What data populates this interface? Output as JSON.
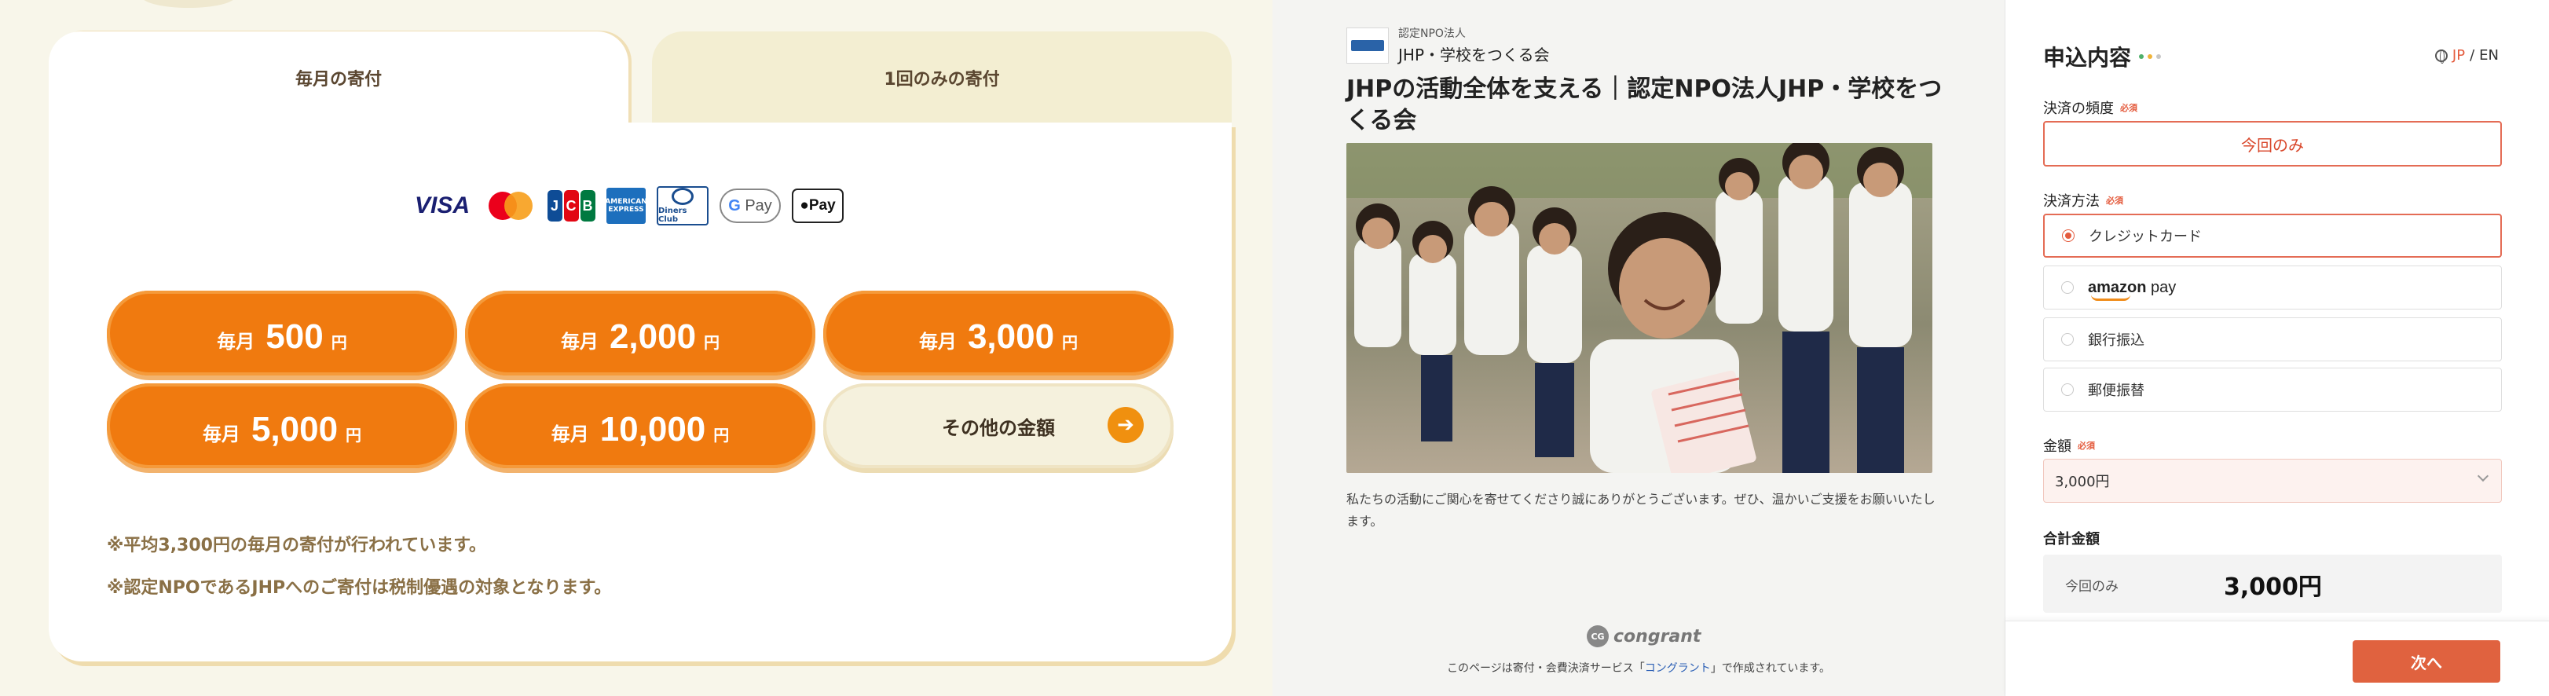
{
  "tabs": {
    "monthly": "毎月の寄付",
    "once": "1回のみの寄付"
  },
  "payment_logos": [
    "visa-icon",
    "mastercard-icon",
    "jcb-icon",
    "amex-icon",
    "diners-icon",
    "google-pay-icon",
    "apple-pay-icon"
  ],
  "logo_text": {
    "visa": "VISA",
    "gpay": "Pay",
    "apay": "Pay",
    "amex": "AMERICAN EXPRESS",
    "diners": "Diners Club"
  },
  "amounts": [
    {
      "prefix": "毎月",
      "value": "500",
      "suffix": "円"
    },
    {
      "prefix": "毎月",
      "value": "2,000",
      "suffix": "円"
    },
    {
      "prefix": "毎月",
      "value": "3,000",
      "suffix": "円"
    },
    {
      "prefix": "毎月",
      "value": "5,000",
      "suffix": "円"
    },
    {
      "prefix": "毎月",
      "value": "10,000",
      "suffix": "円"
    }
  ],
  "other_amount": "その他の金額",
  "notes": [
    "※平均3,300円の毎月の寄付が行われています。",
    "※認定NPOであるJHPへのご寄付は税制優遇の対象となります。"
  ],
  "org": {
    "tag": "認定NPO法人",
    "name": "JHP・学校をつくる会"
  },
  "campaign": {
    "title": "JHPの活動全体を支える｜認定NPO法人JHP・学校をつくる会",
    "description": "私たちの活動にご関心を寄せてくださり誠にありがとうございます。ぜひ、温かいご支援をお願いいたします。"
  },
  "brand": {
    "congrant": "congrant"
  },
  "footer": {
    "pre": "このページは寄付・会費決済サービス「",
    "link": "コングラント",
    "post": "」で作成されています。"
  },
  "form": {
    "title": "申込内容",
    "lang": {
      "jp": "JP",
      "sep": "/",
      "en": "EN"
    },
    "required": "必須",
    "frequency_label": "決済の頻度",
    "frequency_value": "今回のみ",
    "method_label": "決済方法",
    "methods": {
      "credit": "クレジットカード",
      "amazon_word": "amazon",
      "amazon_pay": "pay",
      "bank": "銀行振込",
      "postal": "郵便振替"
    },
    "amount_label": "金額",
    "amount_value": "3,000円",
    "total_label": "合計金額",
    "total_period": "今回のみ",
    "total_value": "3,000円",
    "next": "次へ"
  },
  "colors": {
    "orange": "#f07a0f",
    "accent_red": "#e45b3d",
    "cream": "#f8f6ea"
  }
}
